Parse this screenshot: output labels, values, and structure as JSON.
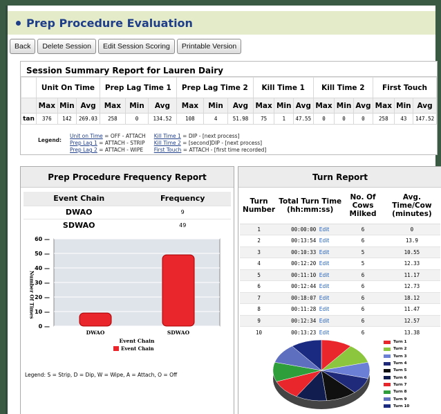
{
  "title": "Prep Procedure Evaluation",
  "toolbar": [
    "Back",
    "Delete Session",
    "Edit Session Scoring",
    "Printable Version"
  ],
  "summary": {
    "title": "Session Summary Report for Lauren Dairy",
    "groups": [
      "Unit On Time",
      "Prep Lag Time 1",
      "Prep Lag Time 2",
      "Kill Time 1",
      "Kill Time 2",
      "First Touch"
    ],
    "sub": [
      "Max",
      "Min",
      "Avg"
    ],
    "row": {
      "label": "tan",
      "values": [
        "376",
        "142",
        "269.03",
        "258",
        "0",
        "134.52",
        "108",
        "4",
        "51.98",
        "75",
        "1",
        "47.55",
        "0",
        "0",
        "0",
        "258",
        "43",
        "147.52"
      ]
    },
    "legend_label": "Legend:",
    "legend_col1": [
      {
        "term": "Unit on Time",
        "def": " = OFF - ATTACH"
      },
      {
        "term": "Prep Lag 1",
        "def": " = ATTACH - STRIP"
      },
      {
        "term": "Prep Lag 2",
        "def": " = ATTACH - WIPE"
      }
    ],
    "legend_col2": [
      {
        "term": "Kill Time 1",
        "def": " = DIP - [next process]"
      },
      {
        "term": "Kill Time 2",
        "def": " = [second]DIP - [next process]"
      },
      {
        "term": "First Touch",
        "def": " = ATTACH - [first time recorded]"
      }
    ]
  },
  "freq": {
    "title": "Prep Procedure Frequency Report",
    "headers": [
      "Event Chain",
      "Frequency"
    ],
    "rows": [
      {
        "name": "DWAO",
        "value": "9"
      },
      {
        "name": "SDWAO",
        "value": "49"
      }
    ],
    "legend": "Legend:  S = Strip,  D = Dip,  W = Wipe,  A = Attach,  O = Off"
  },
  "chart_data": [
    {
      "type": "bar",
      "categories": [
        "DWAO",
        "SDWAO"
      ],
      "values": [
        9,
        49
      ],
      "xlabel": "Event Chain",
      "ylabel": "Number Of Times",
      "ylim": [
        0,
        60
      ],
      "yticks": [
        0,
        10,
        20,
        30,
        40,
        50,
        60
      ],
      "series": [
        {
          "name": "Event Chain",
          "values": [
            9,
            49
          ]
        }
      ],
      "color": "#e8262c",
      "grid": true,
      "legend_position": "bottom"
    },
    {
      "type": "pie",
      "labels": [
        "Turn 1",
        "Turn 2",
        "Turn 3",
        "Turn 4",
        "Turn 5",
        "Turn 6",
        "Turn 7",
        "Turn 8",
        "Turn 9",
        "Turn 10"
      ],
      "values": [
        6,
        6,
        5,
        5,
        6,
        6,
        6,
        6,
        6,
        6
      ],
      "colors": [
        "#e8262c",
        "#8cc63f",
        "#6b7fd6",
        "#1f2a7a",
        "#101010",
        "#111d4f",
        "#e8262c",
        "#2e9e3a",
        "#5f6fc0",
        "#1a2a80"
      ],
      "legend_position": "right"
    }
  ],
  "turn": {
    "title": "Turn Report",
    "headers": [
      "Turn Number",
      "Total Turn Time (hh:mm:ss)",
      "No. Of Cows Milked",
      "Avg. Time/Cow (minutes)"
    ],
    "edit_label": "Edit",
    "rows": [
      {
        "n": "1",
        "t": "00:00:00",
        "c": "6",
        "a": "0"
      },
      {
        "n": "2",
        "t": "00:13:54",
        "c": "6",
        "a": "13.9"
      },
      {
        "n": "3",
        "t": "00:10:33",
        "c": "5",
        "a": "10.55"
      },
      {
        "n": "4",
        "t": "00:12:20",
        "c": "5",
        "a": "12.33"
      },
      {
        "n": "5",
        "t": "00:11:10",
        "c": "6",
        "a": "11.17"
      },
      {
        "n": "6",
        "t": "00:12:44",
        "c": "6",
        "a": "12.73"
      },
      {
        "n": "7",
        "t": "00:18:07",
        "c": "6",
        "a": "18.12"
      },
      {
        "n": "8",
        "t": "00:11:28",
        "c": "6",
        "a": "11.47"
      },
      {
        "n": "9",
        "t": "00:12:34",
        "c": "6",
        "a": "12.57"
      },
      {
        "n": "10",
        "t": "00:13:23",
        "c": "6",
        "a": "13.38"
      }
    ]
  }
}
